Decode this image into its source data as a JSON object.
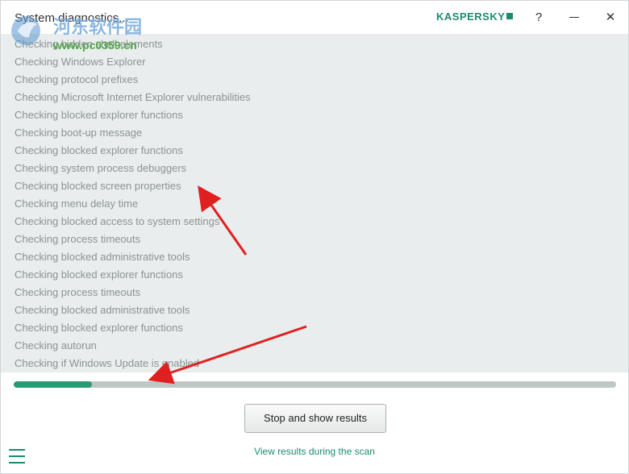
{
  "window": {
    "title": "System diagnostics...",
    "brand": "KASPERSKY",
    "help_label": "?",
    "close_label": "✕"
  },
  "watermark": {
    "cn_text": "河东软件园",
    "url_text": "www.pc0359.cn"
  },
  "log": {
    "lines": [
      "Checking hidden shell elements",
      "Checking Windows Explorer",
      "Checking protocol prefixes",
      "Checking Microsoft Internet Explorer vulnerabilities",
      "Checking blocked explorer functions",
      "Checking boot-up message",
      "Checking blocked explorer functions",
      "Checking system process debuggers",
      "Checking blocked screen properties",
      "Checking menu delay time",
      "Checking blocked access to system settings",
      "Checking process timeouts",
      "Checking blocked administrative tools",
      "Checking blocked explorer functions",
      "Checking process timeouts",
      "Checking blocked administrative tools",
      "Checking blocked explorer functions",
      "Checking autorun",
      "Checking if Windows Update is enabled"
    ]
  },
  "progress": {
    "percent": 13,
    "fill_color": "#2a9a76"
  },
  "actions": {
    "stop_button_label": "Stop and show results",
    "view_results_link": "View results during the scan"
  },
  "colors": {
    "accent": "#1f8a70",
    "log_background": "#e9eded",
    "arrow": "#e02020"
  }
}
